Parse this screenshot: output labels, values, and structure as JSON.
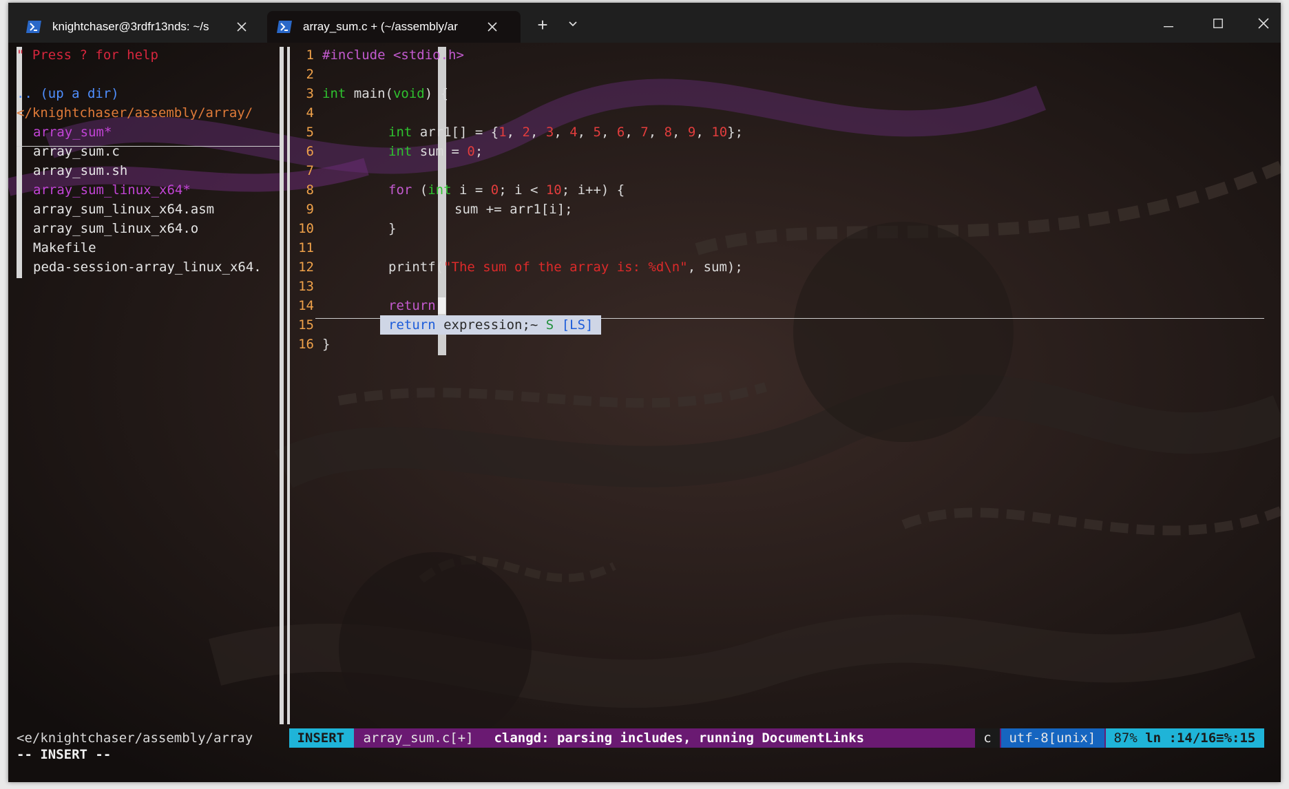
{
  "window": {
    "tabs": [
      {
        "title": "knightchaser@3rdfr13nds: ~/s",
        "active": false
      },
      {
        "title": "array_sum.c + (~/assembly/ar",
        "active": true
      }
    ],
    "new_tab_glyph": "+",
    "dropdown_glyph": "⌄",
    "controls": {
      "minimize": "—",
      "maximize": "☐",
      "close": "✕"
    }
  },
  "explorer": {
    "help": "\" Press ? for help",
    "up_dir": ".. (up a dir)",
    "current_path": "</knightchaser/assembly/array/",
    "entries": [
      {
        "name": "array_sum*",
        "style": "executable-selected"
      },
      {
        "name": "array_sum.c",
        "style": "file"
      },
      {
        "name": "array_sum.sh",
        "style": "file"
      },
      {
        "name": "array_sum_linux_x64*",
        "style": "executable"
      },
      {
        "name": "array_sum_linux_x64.asm",
        "style": "file"
      },
      {
        "name": "array_sum_linux_x64.o",
        "style": "file"
      },
      {
        "name": "Makefile",
        "style": "file"
      },
      {
        "name": "peda-session-array_linux_x64.",
        "style": "file"
      }
    ],
    "status_path": "<e/knightchaser/assembly/array"
  },
  "editor": {
    "line_numbers": [
      "1",
      "2",
      "3",
      "4",
      "5",
      "6",
      "7",
      "8",
      "9",
      "10",
      "11",
      "12",
      "13",
      "14",
      "15",
      "16"
    ],
    "code": {
      "l1_pre": "#include ",
      "l1_header": "<stdio.h>",
      "l3_type": "int",
      "l3_fn": " main(",
      "l3_void": "void",
      "l3_tail": ") {",
      "l5_type": "int",
      "l5_text": " arr1[] = {",
      "l5_nums": [
        "1",
        "2",
        "3",
        "4",
        "5",
        "6",
        "7",
        "8",
        "9",
        "10"
      ],
      "l5_sep": ", ",
      "l5_tail": "};",
      "l6_type": "int",
      "l6_text": " sum = ",
      "l6_num": "0",
      "l6_tail": ";",
      "l8_kw": "for",
      "l8_a": " (",
      "l8_type": "int",
      "l8_b": " i = ",
      "l8_n0": "0",
      "l8_c": "; i < ",
      "l8_n10": "10",
      "l8_d": "; i++) {",
      "l9_text": "sum += arr1[i];",
      "l10_text": "}",
      "l12_fn": "printf(",
      "l12_str": "\"The sum of the array is: %d\\n\"",
      "l12_tail": ", sum);",
      "l14_kw": "return",
      "l16_text": "}"
    },
    "completion": {
      "keyword": "return",
      "text": " expression;~",
      "kind": " S ",
      "source": "[LS]"
    }
  },
  "statusline": {
    "mode": " INSERT ",
    "file": " array_sum.c[+] ",
    "message": " clangd: parsing includes, running DocumentLinks",
    "filetype": " c ",
    "encoding": " utf-8[unix] ",
    "percent": " 87% ",
    "position": "ln :14/16≡%:15 "
  },
  "cmdline": "-- INSERT --",
  "colors": {
    "status_mode_bg": "#1fb4d8",
    "status_mid_bg": "#6a1a72",
    "status_right_bg": "#1fb4d8",
    "encoding_bg": "#1565c0",
    "popup_bg": "#cfd6e6",
    "popup_fg": "#1b5bd9"
  }
}
